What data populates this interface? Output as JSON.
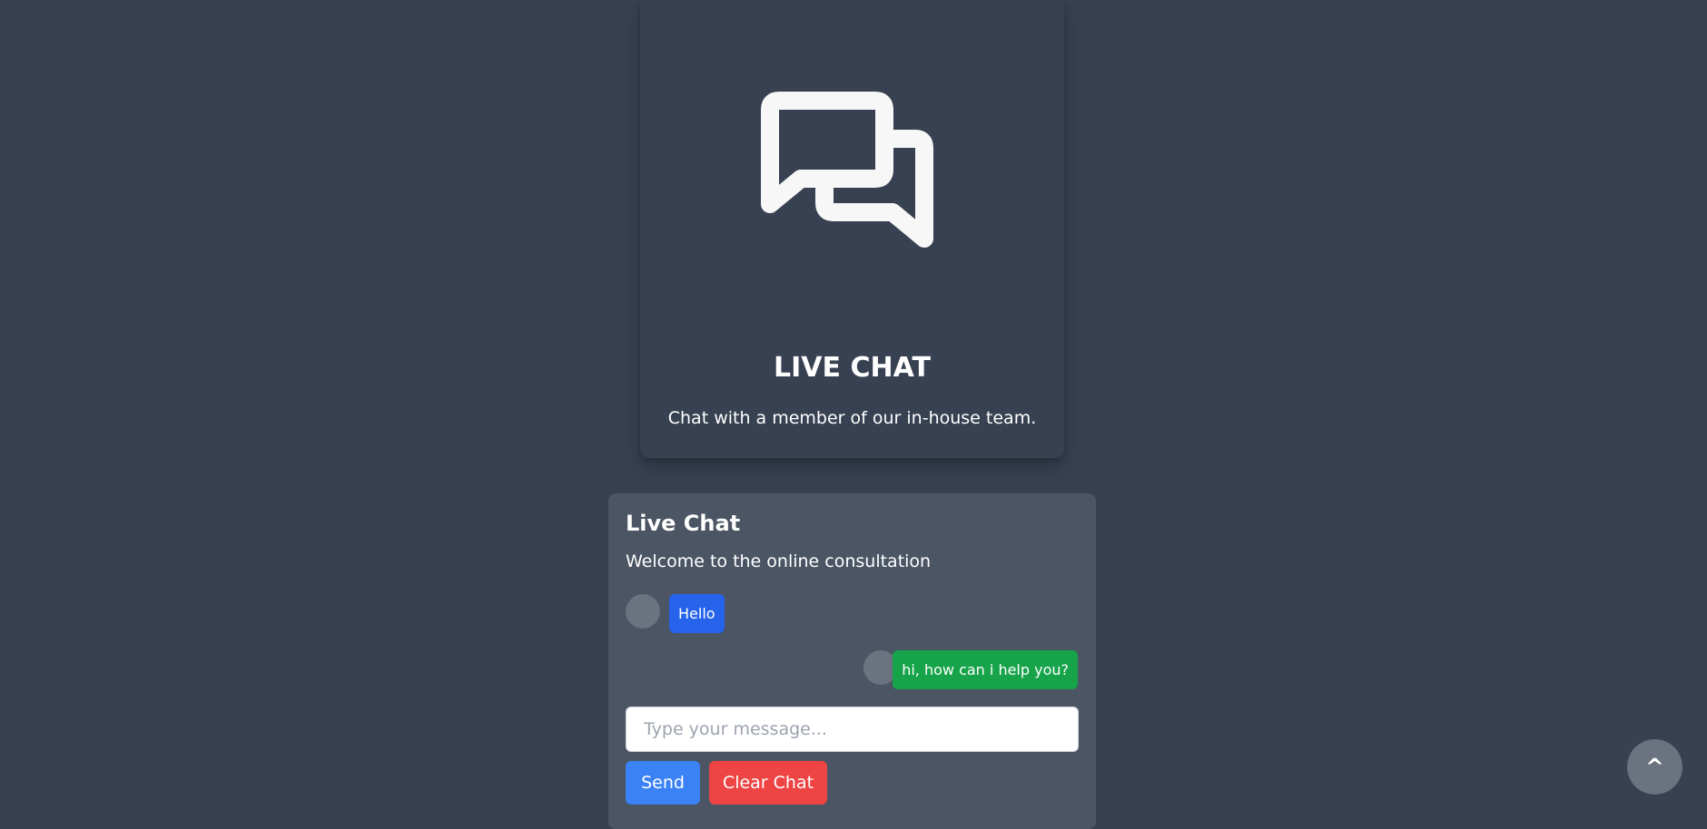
{
  "hero": {
    "icon": "chat-bubbles-icon",
    "title": "LIVE CHAT",
    "subtitle": "Chat with a member of our in-house team."
  },
  "chat": {
    "title": "Live Chat",
    "welcome": "Welcome to the online consultation",
    "messages": [
      {
        "side": "left",
        "text": "Hello",
        "color": "#2563eb"
      },
      {
        "side": "right",
        "text": "hi, how can i help you?",
        "color": "#16a34a"
      }
    ],
    "input_placeholder": "Type your message...",
    "send_label": "Send",
    "clear_label": "Clear Chat"
  },
  "scroll_top": {
    "icon": "caret-up-icon",
    "label": "^"
  },
  "colors": {
    "page_background": "#374151",
    "panel_background": "#4b5563",
    "send_button": "#3b82f6",
    "clear_button": "#ef4444",
    "avatar": "#6b7280"
  }
}
